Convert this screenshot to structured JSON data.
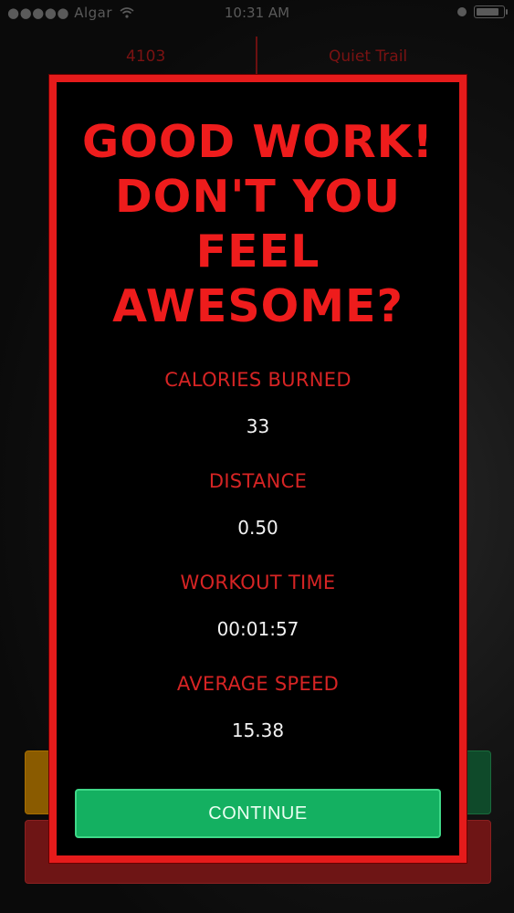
{
  "status_bar": {
    "carrier": "●●●●● Algar",
    "wifi_icon": "wifi-icon",
    "time": "10:31 AM"
  },
  "background": {
    "header_left": "4103",
    "header_right": "Quiet Trail"
  },
  "modal": {
    "title_lines": [
      "GOOD WORK!",
      "DON'T YOU",
      "FEEL",
      "AWESOME?"
    ],
    "stats": [
      {
        "label": "CALORIES BURNED",
        "value": "33"
      },
      {
        "label": "DISTANCE",
        "value": "0.50"
      },
      {
        "label": "WORKOUT TIME",
        "value": "00:01:57"
      },
      {
        "label": "AVERAGE SPEED",
        "value": "15.38"
      }
    ],
    "continue_label": "CONTINUE"
  },
  "colors": {
    "accent_red": "#e51b1b",
    "button_green": "#14b061",
    "background": "#000000"
  }
}
